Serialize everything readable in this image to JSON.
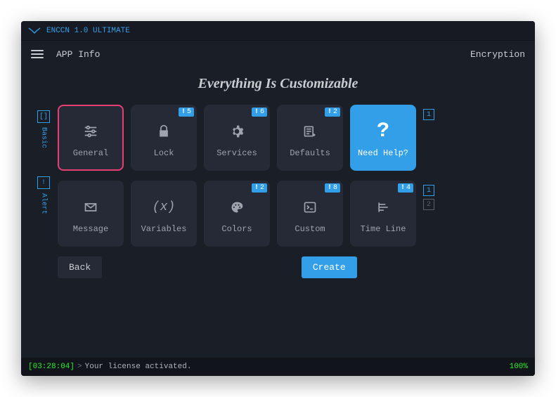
{
  "title": "ENCCN 1.0 ULTIMATE",
  "topbar": {
    "info": "APP Info",
    "right": "Encryption"
  },
  "headline": "Everything Is Customizable",
  "sidemarks": {
    "row1_box": "[]",
    "row1_label": "Basic",
    "row2_box": "!",
    "row2_label": "Alert"
  },
  "endmarks": {
    "row1_a": "1",
    "row2_a": "1",
    "row2_b": "2"
  },
  "tiles": {
    "r1": [
      {
        "label": "General",
        "icon": "sliders",
        "variant": "selected"
      },
      {
        "label": "Lock",
        "icon": "lock",
        "badge": "5"
      },
      {
        "label": "Services",
        "icon": "gear",
        "badge": "6"
      },
      {
        "label": "Defaults",
        "icon": "listplus",
        "badge": "2"
      },
      {
        "label": "Need Help?",
        "icon": "question",
        "variant": "blue"
      }
    ],
    "r2": [
      {
        "label": "Message",
        "icon": "mail"
      },
      {
        "label": "Variables",
        "icon": "varx"
      },
      {
        "label": "Colors",
        "icon": "palette",
        "badge": "2"
      },
      {
        "label": "Custom",
        "icon": "terminal",
        "badge": "8"
      },
      {
        "label": "Time Line",
        "icon": "timeline",
        "badge": "4"
      }
    ]
  },
  "buttons": {
    "back": "Back",
    "create": "Create"
  },
  "status": {
    "ts": "[03:28:04]",
    "prompt": ">",
    "msg": "Your license activated.",
    "pct": "100%"
  }
}
